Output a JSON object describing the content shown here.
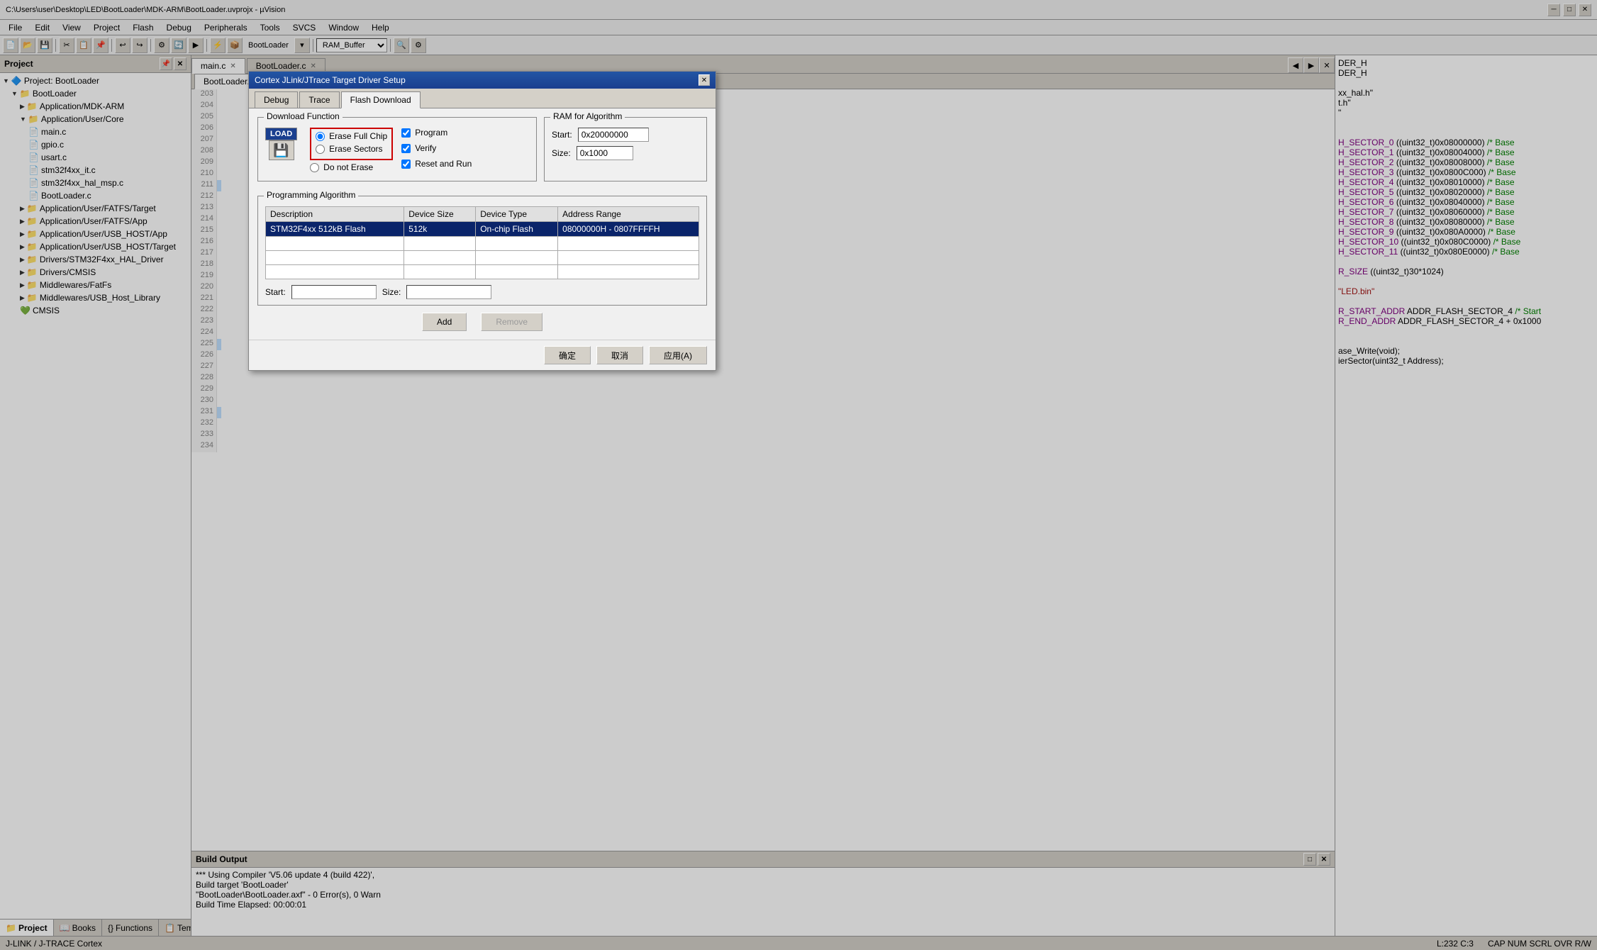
{
  "window": {
    "title": "C:\\Users\\user\\Desktop\\LED\\BootLoader\\MDK-ARM\\BootLoader.uvprojx - µVision",
    "min_btn": "─",
    "max_btn": "□",
    "close_btn": "✕"
  },
  "menu": {
    "items": [
      "File",
      "Edit",
      "View",
      "Project",
      "Flash",
      "Debug",
      "Peripherals",
      "Tools",
      "SVCS",
      "Window",
      "Help"
    ]
  },
  "toolbar": {
    "combo_value": "RAM_Buffer"
  },
  "sidebar": {
    "title": "Project",
    "project_name": "Project: BootLoader",
    "root": "BootLoader",
    "items": [
      {
        "label": "Application/MDK-ARM",
        "indent": 2,
        "type": "folder"
      },
      {
        "label": "Application/User/Core",
        "indent": 2,
        "type": "folder"
      },
      {
        "label": "main.c",
        "indent": 3,
        "type": "file"
      },
      {
        "label": "gpio.c",
        "indent": 3,
        "type": "file"
      },
      {
        "label": "usart.c",
        "indent": 3,
        "type": "file"
      },
      {
        "label": "stm32f4xx_it.c",
        "indent": 3,
        "type": "file"
      },
      {
        "label": "stm32f4xx_hal_msp.c",
        "indent": 3,
        "type": "file"
      },
      {
        "label": "BootLoader.c",
        "indent": 3,
        "type": "file"
      },
      {
        "label": "Application/User/FATFS/Target",
        "indent": 2,
        "type": "folder"
      },
      {
        "label": "Application/User/FATFS/App",
        "indent": 2,
        "type": "folder"
      },
      {
        "label": "Application/User/USB_HOST/App",
        "indent": 2,
        "type": "folder"
      },
      {
        "label": "Application/User/USB_HOST/Target",
        "indent": 2,
        "type": "folder"
      },
      {
        "label": "Drivers/STM32F4xx_HAL_Driver",
        "indent": 2,
        "type": "folder"
      },
      {
        "label": "Drivers/CMSIS",
        "indent": 2,
        "type": "folder"
      },
      {
        "label": "Middlewares/FatFs",
        "indent": 2,
        "type": "folder"
      },
      {
        "label": "Middlewares/USB_Host_Library",
        "indent": 2,
        "type": "folder"
      },
      {
        "label": "CMSIS",
        "indent": 2,
        "type": "cmsis"
      }
    ],
    "bottom_tabs": [
      {
        "label": "Project",
        "icon": "📁",
        "active": true
      },
      {
        "label": "Books",
        "icon": "📖",
        "active": false
      },
      {
        "label": "Functions",
        "icon": "{}",
        "active": false
      },
      {
        "label": "Templates",
        "icon": "📋",
        "active": false
      }
    ]
  },
  "editor": {
    "tabs": [
      {
        "label": "main.c",
        "active": true
      },
      {
        "label": "BootLoader.c",
        "active": false
      },
      {
        "label": "BootLoader.h",
        "active": false
      }
    ],
    "lines": [
      {
        "num": 203,
        "content": ""
      },
      {
        "num": 204,
        "content": ""
      },
      {
        "num": 205,
        "content": ""
      },
      {
        "num": 206,
        "content": ""
      },
      {
        "num": 207,
        "content": ""
      },
      {
        "num": 208,
        "content": ""
      },
      {
        "num": 209,
        "content": ""
      },
      {
        "num": 210,
        "content": ""
      },
      {
        "num": 211,
        "content": ""
      },
      {
        "num": 212,
        "content": ""
      },
      {
        "num": 213,
        "content": ""
      },
      {
        "num": 214,
        "content": ""
      },
      {
        "num": 215,
        "content": ""
      },
      {
        "num": 216,
        "content": ""
      },
      {
        "num": 217,
        "content": ""
      },
      {
        "num": 218,
        "content": ""
      },
      {
        "num": 219,
        "content": ""
      },
      {
        "num": 220,
        "content": ""
      },
      {
        "num": 221,
        "content": ""
      },
      {
        "num": 222,
        "content": ""
      },
      {
        "num": 223,
        "content": ""
      },
      {
        "num": 224,
        "content": ""
      },
      {
        "num": 225,
        "content": ""
      },
      {
        "num": 226,
        "content": ""
      },
      {
        "num": 227,
        "content": ""
      },
      {
        "num": 228,
        "content": ""
      },
      {
        "num": 229,
        "content": ""
      },
      {
        "num": 230,
        "content": ""
      },
      {
        "num": 231,
        "content": ""
      },
      {
        "num": 232,
        "content": ""
      },
      {
        "num": 233,
        "content": ""
      },
      {
        "num": 234,
        "content": ""
      }
    ]
  },
  "right_panel": {
    "lines": [
      "DER_H",
      "DER_H",
      "",
      "xx_hal.h\"",
      "t.h\"",
      "\"",
      "",
      "",
      "H_SECTOR_0    ((uint32_t)0x08000000)  /* Base",
      "H_SECTOR_1    ((uint32_t)0x08004000)  /* Base",
      "H_SECTOR_2    ((uint32_t)0x08008000)  /* Base",
      "H_SECTOR_3    ((uint32_t)0x0800C000)  /* Base",
      "H_SECTOR_4    ((uint32_t)0x08010000)  /* Base",
      "H_SECTOR_5    ((uint32_t)0x08020000)  /* Base",
      "H_SECTOR_6    ((uint32_t)0x08040000)  /* Base",
      "H_SECTOR_7    ((uint32_t)0x08060000)  /* Base",
      "H_SECTOR_8    ((uint32_t)0x08080000)  /* Base",
      "H_SECTOR_9    ((uint32_t)0x080A0000)  /* Base",
      "H_SECTOR_10   ((uint32_t)0x080C0000)  /* Base",
      "H_SECTOR_11   ((uint32_t)0x080E0000)  /* Base",
      "",
      "R_SIZE        ((uint32_t)30*1024)",
      "",
      "\"LED.bin\"",
      "",
      "R_START_ADDR  ADDR_FLASH_SECTOR_4  /* Start",
      "R_END_ADDR    ADDR_FLASH_SECTOR_4 + 0x1000",
      "",
      "",
      "ase_Write(void);",
      "ierSector(uint32_t Address);"
    ]
  },
  "build_output": {
    "title": "Build Output",
    "lines": [
      "*** Using Compiler 'V5.06 update 4 (build 422)',",
      "Build target 'BootLoader'",
      "\"BootLoader\\BootLoader.axf\" - 0 Error(s), 0 Warn",
      "Build Time Elapsed:  00:00:01"
    ]
  },
  "status_bar": {
    "jlink": "J-LINK / J-TRACE Cortex",
    "position": "L:232 C:3",
    "caps": "CAP NUM SCRL OVR R/W"
  },
  "dialog": {
    "title": "Cortex JLink/JTrace Target Driver Setup",
    "close_btn": "✕",
    "tabs": [
      {
        "label": "Debug",
        "active": false
      },
      {
        "label": "Trace",
        "active": false
      },
      {
        "label": "Flash Download",
        "active": true
      }
    ],
    "download_function": {
      "title": "Download Function",
      "load_icon": "LOAD",
      "options": [
        {
          "label": "Erase Full Chip",
          "selected": true,
          "highlighted": true
        },
        {
          "label": "Erase Sectors",
          "selected": false,
          "highlighted": true
        },
        {
          "label": "Do not Erase",
          "selected": false,
          "highlighted": false
        }
      ],
      "right_options": [
        {
          "label": "Program",
          "checked": true
        },
        {
          "label": "Verify",
          "checked": true
        },
        {
          "label": "Reset and Run",
          "checked": true
        }
      ]
    },
    "ram_algorithm": {
      "title": "RAM for Algorithm",
      "start_label": "Start:",
      "start_value": "0x20000000",
      "size_label": "Size:",
      "size_value": "0x1000"
    },
    "programming_algorithm": {
      "title": "Programming Algorithm",
      "columns": [
        "Description",
        "Device Size",
        "Device Type",
        "Address Range"
      ],
      "rows": [
        {
          "description": "STM32F4xx 512kB Flash",
          "device_size": "512k",
          "device_type": "On-chip Flash",
          "address_range": "08000000H - 0807FFFFH"
        }
      ],
      "start_label": "Start:",
      "start_value": "",
      "size_label": "Size:",
      "size_value": ""
    },
    "buttons": {
      "add": "Add",
      "remove": "Remove",
      "ok": "确定",
      "cancel": "取消",
      "apply": "应用(A)"
    }
  }
}
